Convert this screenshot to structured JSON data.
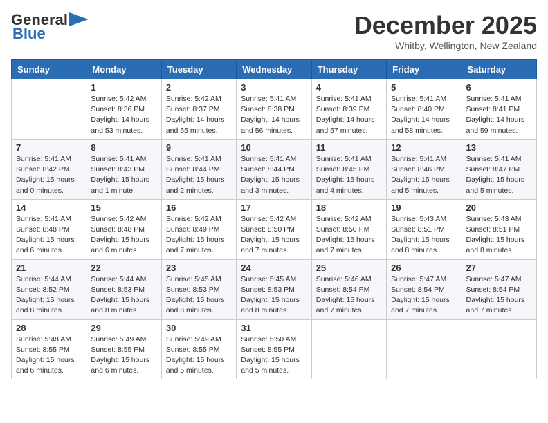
{
  "header": {
    "logo_general": "General",
    "logo_blue": "Blue",
    "month_title": "December 2025",
    "location": "Whitby, Wellington, New Zealand"
  },
  "calendar": {
    "days_of_week": [
      "Sunday",
      "Monday",
      "Tuesday",
      "Wednesday",
      "Thursday",
      "Friday",
      "Saturday"
    ],
    "weeks": [
      [
        {
          "day": "",
          "info": ""
        },
        {
          "day": "1",
          "info": "Sunrise: 5:42 AM\nSunset: 8:36 PM\nDaylight: 14 hours\nand 53 minutes."
        },
        {
          "day": "2",
          "info": "Sunrise: 5:42 AM\nSunset: 8:37 PM\nDaylight: 14 hours\nand 55 minutes."
        },
        {
          "day": "3",
          "info": "Sunrise: 5:41 AM\nSunset: 8:38 PM\nDaylight: 14 hours\nand 56 minutes."
        },
        {
          "day": "4",
          "info": "Sunrise: 5:41 AM\nSunset: 8:39 PM\nDaylight: 14 hours\nand 57 minutes."
        },
        {
          "day": "5",
          "info": "Sunrise: 5:41 AM\nSunset: 8:40 PM\nDaylight: 14 hours\nand 58 minutes."
        },
        {
          "day": "6",
          "info": "Sunrise: 5:41 AM\nSunset: 8:41 PM\nDaylight: 14 hours\nand 59 minutes."
        }
      ],
      [
        {
          "day": "7",
          "info": "Sunrise: 5:41 AM\nSunset: 8:42 PM\nDaylight: 15 hours\nand 0 minutes."
        },
        {
          "day": "8",
          "info": "Sunrise: 5:41 AM\nSunset: 8:43 PM\nDaylight: 15 hours\nand 1 minute."
        },
        {
          "day": "9",
          "info": "Sunrise: 5:41 AM\nSunset: 8:44 PM\nDaylight: 15 hours\nand 2 minutes."
        },
        {
          "day": "10",
          "info": "Sunrise: 5:41 AM\nSunset: 8:44 PM\nDaylight: 15 hours\nand 3 minutes."
        },
        {
          "day": "11",
          "info": "Sunrise: 5:41 AM\nSunset: 8:45 PM\nDaylight: 15 hours\nand 4 minutes."
        },
        {
          "day": "12",
          "info": "Sunrise: 5:41 AM\nSunset: 8:46 PM\nDaylight: 15 hours\nand 5 minutes."
        },
        {
          "day": "13",
          "info": "Sunrise: 5:41 AM\nSunset: 8:47 PM\nDaylight: 15 hours\nand 5 minutes."
        }
      ],
      [
        {
          "day": "14",
          "info": "Sunrise: 5:41 AM\nSunset: 8:48 PM\nDaylight: 15 hours\nand 6 minutes."
        },
        {
          "day": "15",
          "info": "Sunrise: 5:42 AM\nSunset: 8:48 PM\nDaylight: 15 hours\nand 6 minutes."
        },
        {
          "day": "16",
          "info": "Sunrise: 5:42 AM\nSunset: 8:49 PM\nDaylight: 15 hours\nand 7 minutes."
        },
        {
          "day": "17",
          "info": "Sunrise: 5:42 AM\nSunset: 8:50 PM\nDaylight: 15 hours\nand 7 minutes."
        },
        {
          "day": "18",
          "info": "Sunrise: 5:42 AM\nSunset: 8:50 PM\nDaylight: 15 hours\nand 7 minutes."
        },
        {
          "day": "19",
          "info": "Sunrise: 5:43 AM\nSunset: 8:51 PM\nDaylight: 15 hours\nand 8 minutes."
        },
        {
          "day": "20",
          "info": "Sunrise: 5:43 AM\nSunset: 8:51 PM\nDaylight: 15 hours\nand 8 minutes."
        }
      ],
      [
        {
          "day": "21",
          "info": "Sunrise: 5:44 AM\nSunset: 8:52 PM\nDaylight: 15 hours\nand 8 minutes."
        },
        {
          "day": "22",
          "info": "Sunrise: 5:44 AM\nSunset: 8:53 PM\nDaylight: 15 hours\nand 8 minutes."
        },
        {
          "day": "23",
          "info": "Sunrise: 5:45 AM\nSunset: 8:53 PM\nDaylight: 15 hours\nand 8 minutes."
        },
        {
          "day": "24",
          "info": "Sunrise: 5:45 AM\nSunset: 8:53 PM\nDaylight: 15 hours\nand 8 minutes."
        },
        {
          "day": "25",
          "info": "Sunrise: 5:46 AM\nSunset: 8:54 PM\nDaylight: 15 hours\nand 7 minutes."
        },
        {
          "day": "26",
          "info": "Sunrise: 5:47 AM\nSunset: 8:54 PM\nDaylight: 15 hours\nand 7 minutes."
        },
        {
          "day": "27",
          "info": "Sunrise: 5:47 AM\nSunset: 8:54 PM\nDaylight: 15 hours\nand 7 minutes."
        }
      ],
      [
        {
          "day": "28",
          "info": "Sunrise: 5:48 AM\nSunset: 8:55 PM\nDaylight: 15 hours\nand 6 minutes."
        },
        {
          "day": "29",
          "info": "Sunrise: 5:49 AM\nSunset: 8:55 PM\nDaylight: 15 hours\nand 6 minutes."
        },
        {
          "day": "30",
          "info": "Sunrise: 5:49 AM\nSunset: 8:55 PM\nDaylight: 15 hours\nand 5 minutes."
        },
        {
          "day": "31",
          "info": "Sunrise: 5:50 AM\nSunset: 8:55 PM\nDaylight: 15 hours\nand 5 minutes."
        },
        {
          "day": "",
          "info": ""
        },
        {
          "day": "",
          "info": ""
        },
        {
          "day": "",
          "info": ""
        }
      ]
    ]
  }
}
